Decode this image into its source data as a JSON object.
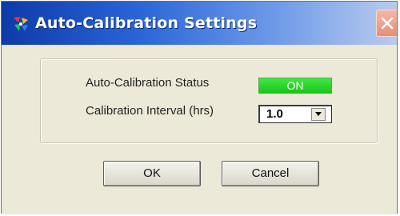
{
  "window": {
    "title": "Auto-Calibration Settings",
    "icon": "calibration-app-icon",
    "close_icon": "close-icon"
  },
  "settings": {
    "status_label": "Auto-Calibration Status",
    "status_value": "ON",
    "status_color": "#2ad42a",
    "interval_label": "Calibration Interval (hrs)",
    "interval_value": "1.0"
  },
  "buttons": {
    "ok_label": "OK",
    "cancel_label": "Cancel"
  }
}
